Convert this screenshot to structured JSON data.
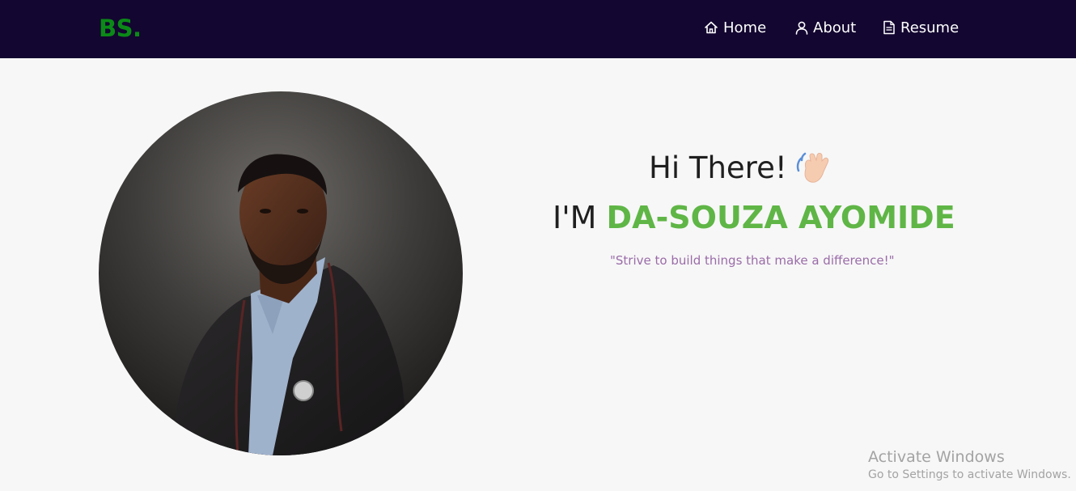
{
  "navbar": {
    "logo": "BS.",
    "items": [
      {
        "label": "Home",
        "icon": "home-icon"
      },
      {
        "label": "About",
        "icon": "user-icon"
      },
      {
        "label": "Resume",
        "icon": "document-icon"
      }
    ]
  },
  "hero": {
    "greeting": "Hi There!",
    "greeting_icon": "waving-hand-icon",
    "intro_prefix": "I'M",
    "name": "DA-SOUZA AYOMIDE",
    "quote": "\"Strive to build things that make a difference!\"",
    "portrait": "profile-photo"
  },
  "watermark": {
    "title": "Activate Windows",
    "subtitle": "Go to Settings to activate Windows."
  },
  "colors": {
    "navbar_bg": "#130630",
    "logo": "#0b8a17",
    "accent_name": "#5fb646",
    "quote": "#9a6ca8",
    "page_bg": "#f7f7f7"
  }
}
